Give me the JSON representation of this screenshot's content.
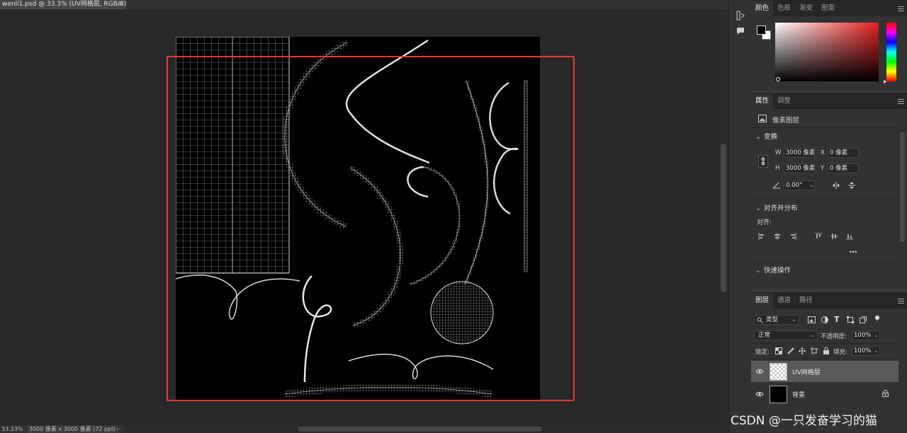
{
  "document": {
    "tab_title": "wenli1.psd @ 33.3% (UV网格层, RGB/8)",
    "close_glyph": "×"
  },
  "status": {
    "zoom": "33.33%",
    "doc_info": "3000 像素 x 3000 像素 (72 ppi)",
    "arrow": "›"
  },
  "color_panel": {
    "tabs": [
      "颜色",
      "色板",
      "渐变",
      "图案"
    ],
    "foreground": "#000000",
    "background": "#ffffff",
    "hue_color": "#e61e1e"
  },
  "properties_panel": {
    "tabs": [
      "属性",
      "调整"
    ],
    "layer_type": "像素图层",
    "transform": {
      "heading": "变换",
      "w_label": "W",
      "w_value": "3000 像素",
      "x_label": "X",
      "x_value": "0 像素",
      "h_label": "H",
      "h_value": "3000 像素",
      "y_label": "Y",
      "y_value": "0 像素",
      "angle": "0.00°"
    },
    "align": {
      "heading": "对齐并分布",
      "label": "对齐:",
      "more": "•••"
    },
    "quick_actions": "快速操作"
  },
  "layers_panel": {
    "tabs": [
      "图层",
      "通道",
      "路径"
    ],
    "filter_kind": "类型",
    "blend_mode": "正常",
    "opacity_label": "不透明度:",
    "opacity_value": "100%",
    "lock_label": "锁定:",
    "fill_label": "填充:",
    "fill_value": "100%",
    "layers": [
      {
        "name": "UV网格层",
        "selected": true,
        "locked": false
      },
      {
        "name": "背景",
        "selected": false,
        "locked": true
      }
    ]
  },
  "watermark": "CSDN @一只发奋学习的猫",
  "accent_colors": {
    "highlight_red": "#e53935",
    "panel_bg": "#323232",
    "workspace_bg": "#282828"
  }
}
